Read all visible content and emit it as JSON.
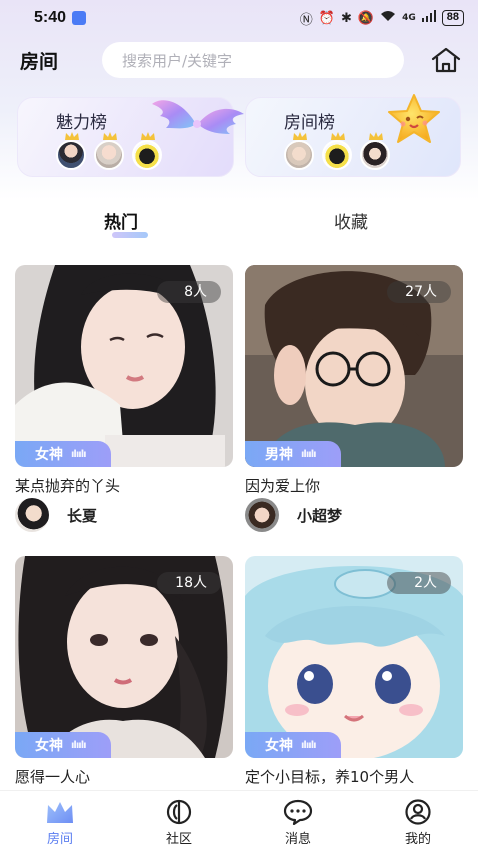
{
  "status_bar": {
    "time": "5:40",
    "battery": "88",
    "network": "4G"
  },
  "header": {
    "title": "房间",
    "search_placeholder": "搜索用户/关键字"
  },
  "rankings": {
    "charm": {
      "label": "魅力榜"
    },
    "room": {
      "label": "房间榜"
    }
  },
  "tabs": {
    "hot": "热门",
    "favorites": "收藏"
  },
  "rooms": [
    {
      "title": "某点抛弃的丫头",
      "user": "长夏",
      "count": "8人",
      "tag": "女神"
    },
    {
      "title": "因为爱上你",
      "user": "小超梦",
      "count": "27人",
      "tag": "男神"
    },
    {
      "title": "愿得一人心",
      "user": "",
      "count": "18人",
      "tag": "女神"
    },
    {
      "title": "定个小目标，养10个男人",
      "user": "",
      "count": "2人",
      "tag": "女神"
    }
  ],
  "bottom_nav": {
    "room": "房间",
    "community": "社区",
    "messages": "消息",
    "mine": "我的"
  },
  "colors": {
    "accent": "#5b7ef0",
    "tag_gradient_start": "#7aa8f5",
    "tag_gradient_end": "#9d9ef8"
  }
}
